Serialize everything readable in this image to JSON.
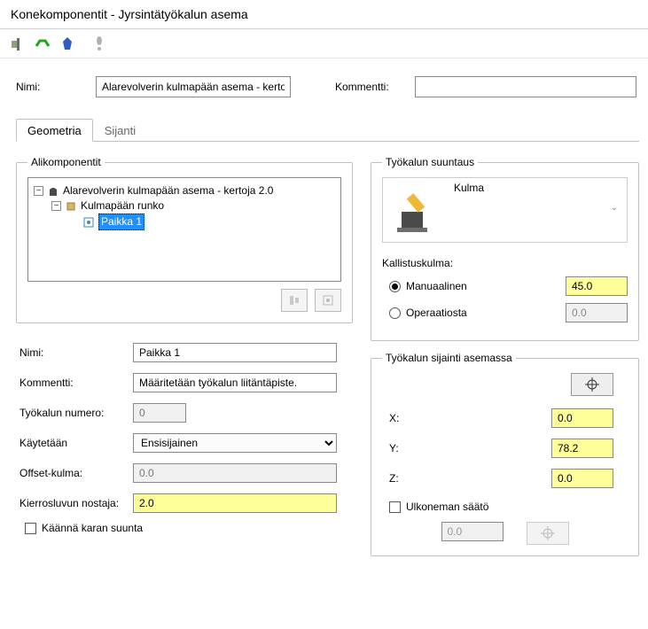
{
  "window_title": "Konekomponentit - Jyrsintätyökalun asema",
  "labels": {
    "name": "Nimi:",
    "comment": "Kommentti:"
  },
  "name_value": "Alarevolverin kulmapään asema - kertoja",
  "comment_value": "",
  "tabs": {
    "geometry": "Geometria",
    "location": "Sijanti"
  },
  "subcomponents": {
    "legend": "Alikomponentit",
    "root": "Alarevolverin kulmapään asema - kertoja 2.0",
    "child1": "Kulmapään runko",
    "child2": "Paikka 1"
  },
  "form": {
    "name_label": "Nimi:",
    "name_value": "Paikka 1",
    "comment_label": "Kommentti:",
    "comment_value": "Määritetään työkalun liitäntäpiste.",
    "toolnum_label": "Työkalun numero:",
    "toolnum_value": "0",
    "used_label": "Käytetään",
    "used_value": "Ensisijainen",
    "offset_label": "Offset-kulma:",
    "offset_value": "0.0",
    "rpm_label": "Kierrosluvun nostaja:",
    "rpm_value": "2.0",
    "flip_label": "Käännä karan suunta"
  },
  "orientation": {
    "legend": "Työkalun suuntaus",
    "mode": "Kulma",
    "tilt_label": "Kallistuskulma:",
    "manual_label": "Manuaalinen",
    "manual_value": "45.0",
    "op_label": "Operaatiosta",
    "op_value": "0.0"
  },
  "position": {
    "legend": "Työkalun sijainti asemassa",
    "x_label": "X:",
    "x_value": "0.0",
    "y_label": "Y:",
    "y_value": "78.2",
    "z_label": "Z:",
    "z_value": "0.0",
    "ext_label": "Ulkoneman säätö",
    "ext_value": "0.0"
  }
}
